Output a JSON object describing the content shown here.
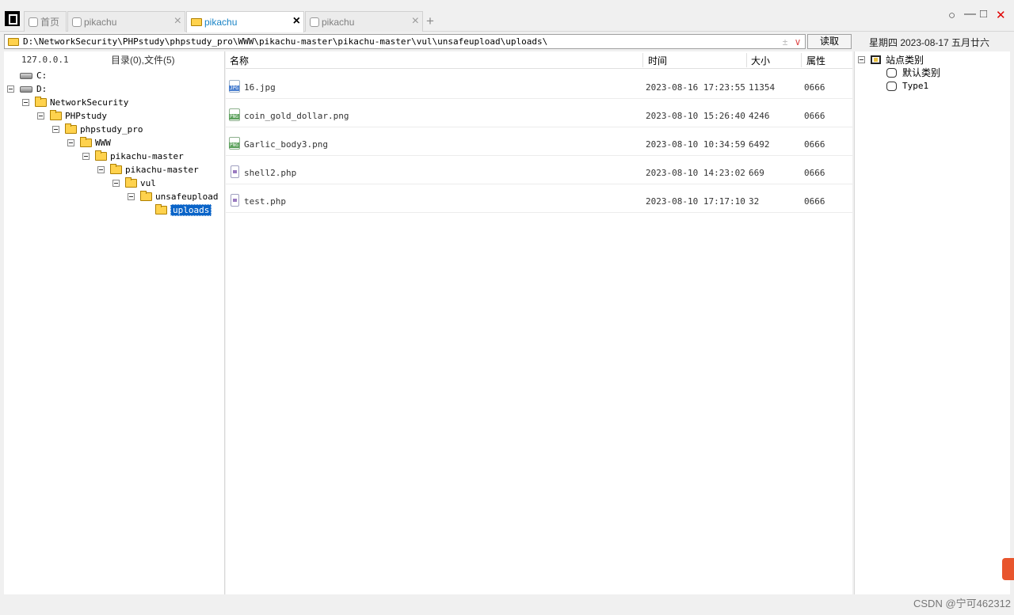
{
  "tabs": [
    {
      "label": "首页"
    },
    {
      "label": "pikachu"
    },
    {
      "label": "pikachu"
    },
    {
      "label": "pikachu"
    }
  ],
  "tab_add_label": "+",
  "window_controls": {
    "circle": "○",
    "minimize": "—",
    "maximize": "□",
    "close": "✕"
  },
  "pathbar": {
    "path": "D:\\NetworkSecurity\\PHPstudy\\phpstudy_pro\\WWW\\pikachu-master\\pikachu-master\\vul\\unsafeupload\\uploads\\",
    "plus": "±",
    "dropdown": "∨"
  },
  "read_button": "读取",
  "date_text": "星期四 2023-08-17 五月廿六",
  "left_pane": {
    "host": "127.0.0.1",
    "counts": "目录(0),文件(5)",
    "tree": [
      {
        "label": "C:"
      },
      {
        "label": "D:"
      },
      {
        "label": "NetworkSecurity"
      },
      {
        "label": "PHPstudy"
      },
      {
        "label": "phpstudy_pro"
      },
      {
        "label": "WWW"
      },
      {
        "label": "pikachu-master"
      },
      {
        "label": "pikachu-master"
      },
      {
        "label": "vul"
      },
      {
        "label": "unsafeupload"
      },
      {
        "label": "uploads"
      }
    ]
  },
  "file_table": {
    "columns": [
      "名称",
      "时间",
      "大小",
      "属性"
    ],
    "rows": [
      {
        "name": "16.jpg",
        "time": "2023-08-16 17:23:55",
        "size": "11354",
        "attr": "0666",
        "icon": "jpg-file-icon"
      },
      {
        "name": "coin_gold_dollar.png",
        "time": "2023-08-10 15:26:40",
        "size": "4246",
        "attr": "0666",
        "icon": "png-file-icon"
      },
      {
        "name": "Garlic_body3.png",
        "time": "2023-08-10 10:34:59",
        "size": "6492",
        "attr": "0666",
        "icon": "png-file-icon"
      },
      {
        "name": "shell2.php",
        "time": "2023-08-10 14:23:02",
        "size": "669",
        "attr": "0666",
        "icon": "php-file-icon"
      },
      {
        "name": "test.php",
        "time": "2023-08-10 17:17:10",
        "size": "32",
        "attr": "0666",
        "icon": "php-file-icon"
      }
    ]
  },
  "right_pane": {
    "root": "站点类别",
    "items": [
      {
        "label": "默认类别"
      },
      {
        "label": "Type1"
      }
    ]
  },
  "watermark": "CSDN @宁可462312",
  "colors": {
    "accent": "#1a84c6",
    "selection": "#0a64c8",
    "folder": "#ffd24d",
    "close_red": "#e00000"
  }
}
